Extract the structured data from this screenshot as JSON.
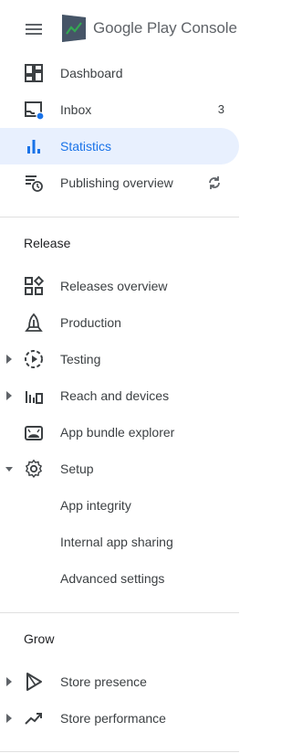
{
  "app": {
    "brand_main": "Google Play",
    "brand_sub": "Console"
  },
  "nav_top": [
    {
      "label": "Dashboard",
      "icon": "dashboard-icon"
    },
    {
      "label": "Inbox",
      "icon": "inbox-icon",
      "count": "3"
    },
    {
      "label": "Statistics",
      "icon": "statistics-icon",
      "active": true
    },
    {
      "label": "Publishing overview",
      "icon": "publishing-overview-icon",
      "trail_icon": "sync-icon"
    }
  ],
  "release": {
    "title": "Release",
    "items": [
      {
        "label": "Releases overview",
        "icon": "releases-overview-icon"
      },
      {
        "label": "Production",
        "icon": "production-icon"
      },
      {
        "label": "Testing",
        "icon": "testing-icon",
        "caret": "collapsed"
      },
      {
        "label": "Reach and devices",
        "icon": "reach-icon",
        "caret": "collapsed"
      },
      {
        "label": "App bundle explorer",
        "icon": "android-icon"
      },
      {
        "label": "Setup",
        "icon": "gear-icon",
        "caret": "expanded"
      },
      {
        "label": "App integrity"
      },
      {
        "label": "Internal app sharing"
      },
      {
        "label": "Advanced settings"
      }
    ]
  },
  "grow": {
    "title": "Grow",
    "items": [
      {
        "label": "Store presence",
        "icon": "store-presence-icon",
        "caret": "collapsed"
      },
      {
        "label": "Store performance",
        "icon": "trending-up-icon",
        "caret": "collapsed"
      }
    ]
  },
  "colors": {
    "accent": "#1a73e8",
    "active_bg": "#e8f0fe",
    "text": "#3c4043",
    "icon": "#5f6368"
  }
}
